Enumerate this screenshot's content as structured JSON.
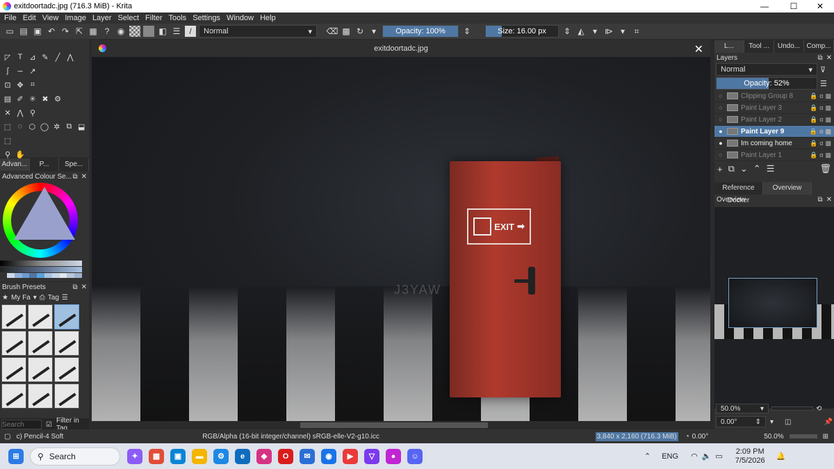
{
  "window": {
    "title": "exitdoortadc.jpg (716.3 MiB)  - Krita",
    "min": "—",
    "max": "☐",
    "close": "✕"
  },
  "menu": [
    "File",
    "Edit",
    "View",
    "Image",
    "Layer",
    "Select",
    "Filter",
    "Tools",
    "Settings",
    "Window",
    "Help"
  ],
  "toolbar": {
    "blend_mode": "Normal",
    "opacity": "Opacity: 100%",
    "size": "Size: 16.00 px",
    "opacity_level": 1.0
  },
  "left_tabs": [
    "Advan...",
    "P...",
    "Spe..."
  ],
  "color_docker": {
    "title": "Advanced Colour Se...",
    "swatches": [
      "#cfd8e8",
      "#8fb0d8",
      "#6c9ad0",
      "#4f77a3",
      "#5aa2d8",
      "#a9c4e2",
      "#c9d6e6",
      "#e0e6ee",
      "#b8c6d8",
      "#9db2cc"
    ]
  },
  "brush_docker": {
    "title": "Brush Presets",
    "tag_filter": "My Fa",
    "tag_label": "Tag",
    "search_placeholder": "Search",
    "filter_label": "Filter in Tag"
  },
  "canvas": {
    "tab_title": "exitdoortadc.jpg",
    "exit_text": "EXIT",
    "watermark": "J3YAW"
  },
  "right_tabs": [
    "L...",
    "Tool ...",
    "Undo...",
    "Comp..."
  ],
  "layers": {
    "title": "Layers",
    "blend": "Normal",
    "opacity_label": "Opacity:",
    "opacity_value": "52%",
    "opacity_level": 0.52,
    "items": [
      {
        "name": "Clipping Group 8",
        "visible": false,
        "current": false
      },
      {
        "name": "Paint Layer 3",
        "visible": false,
        "current": false
      },
      {
        "name": "Paint Layer 2",
        "visible": false,
        "current": false
      },
      {
        "name": "Paint Layer 9",
        "visible": true,
        "current": true
      },
      {
        "name": "Im coming home",
        "visible": true,
        "current": false
      },
      {
        "name": "Paint Layer 1",
        "visible": false,
        "current": false
      }
    ]
  },
  "lower_tabs": [
    "Reference Docker",
    "Overview"
  ],
  "overview": {
    "title": "Overview",
    "zoom": "50.0%",
    "rotation": "0.00°"
  },
  "status": {
    "brush": "c) Pencil-4 Soft",
    "color_profile": "RGB/Alpha (16-bit integer/channel)  sRGB-elle-V2-g10.icc",
    "dimensions": "3,840 x 2,160 (716.3 MiB)",
    "rotation": "0.00°",
    "zoom": "50.0%"
  },
  "taskbar": {
    "search": "Search",
    "lang": "ENG",
    "time": "2:09 PM",
    "date": "7/5/2026"
  }
}
